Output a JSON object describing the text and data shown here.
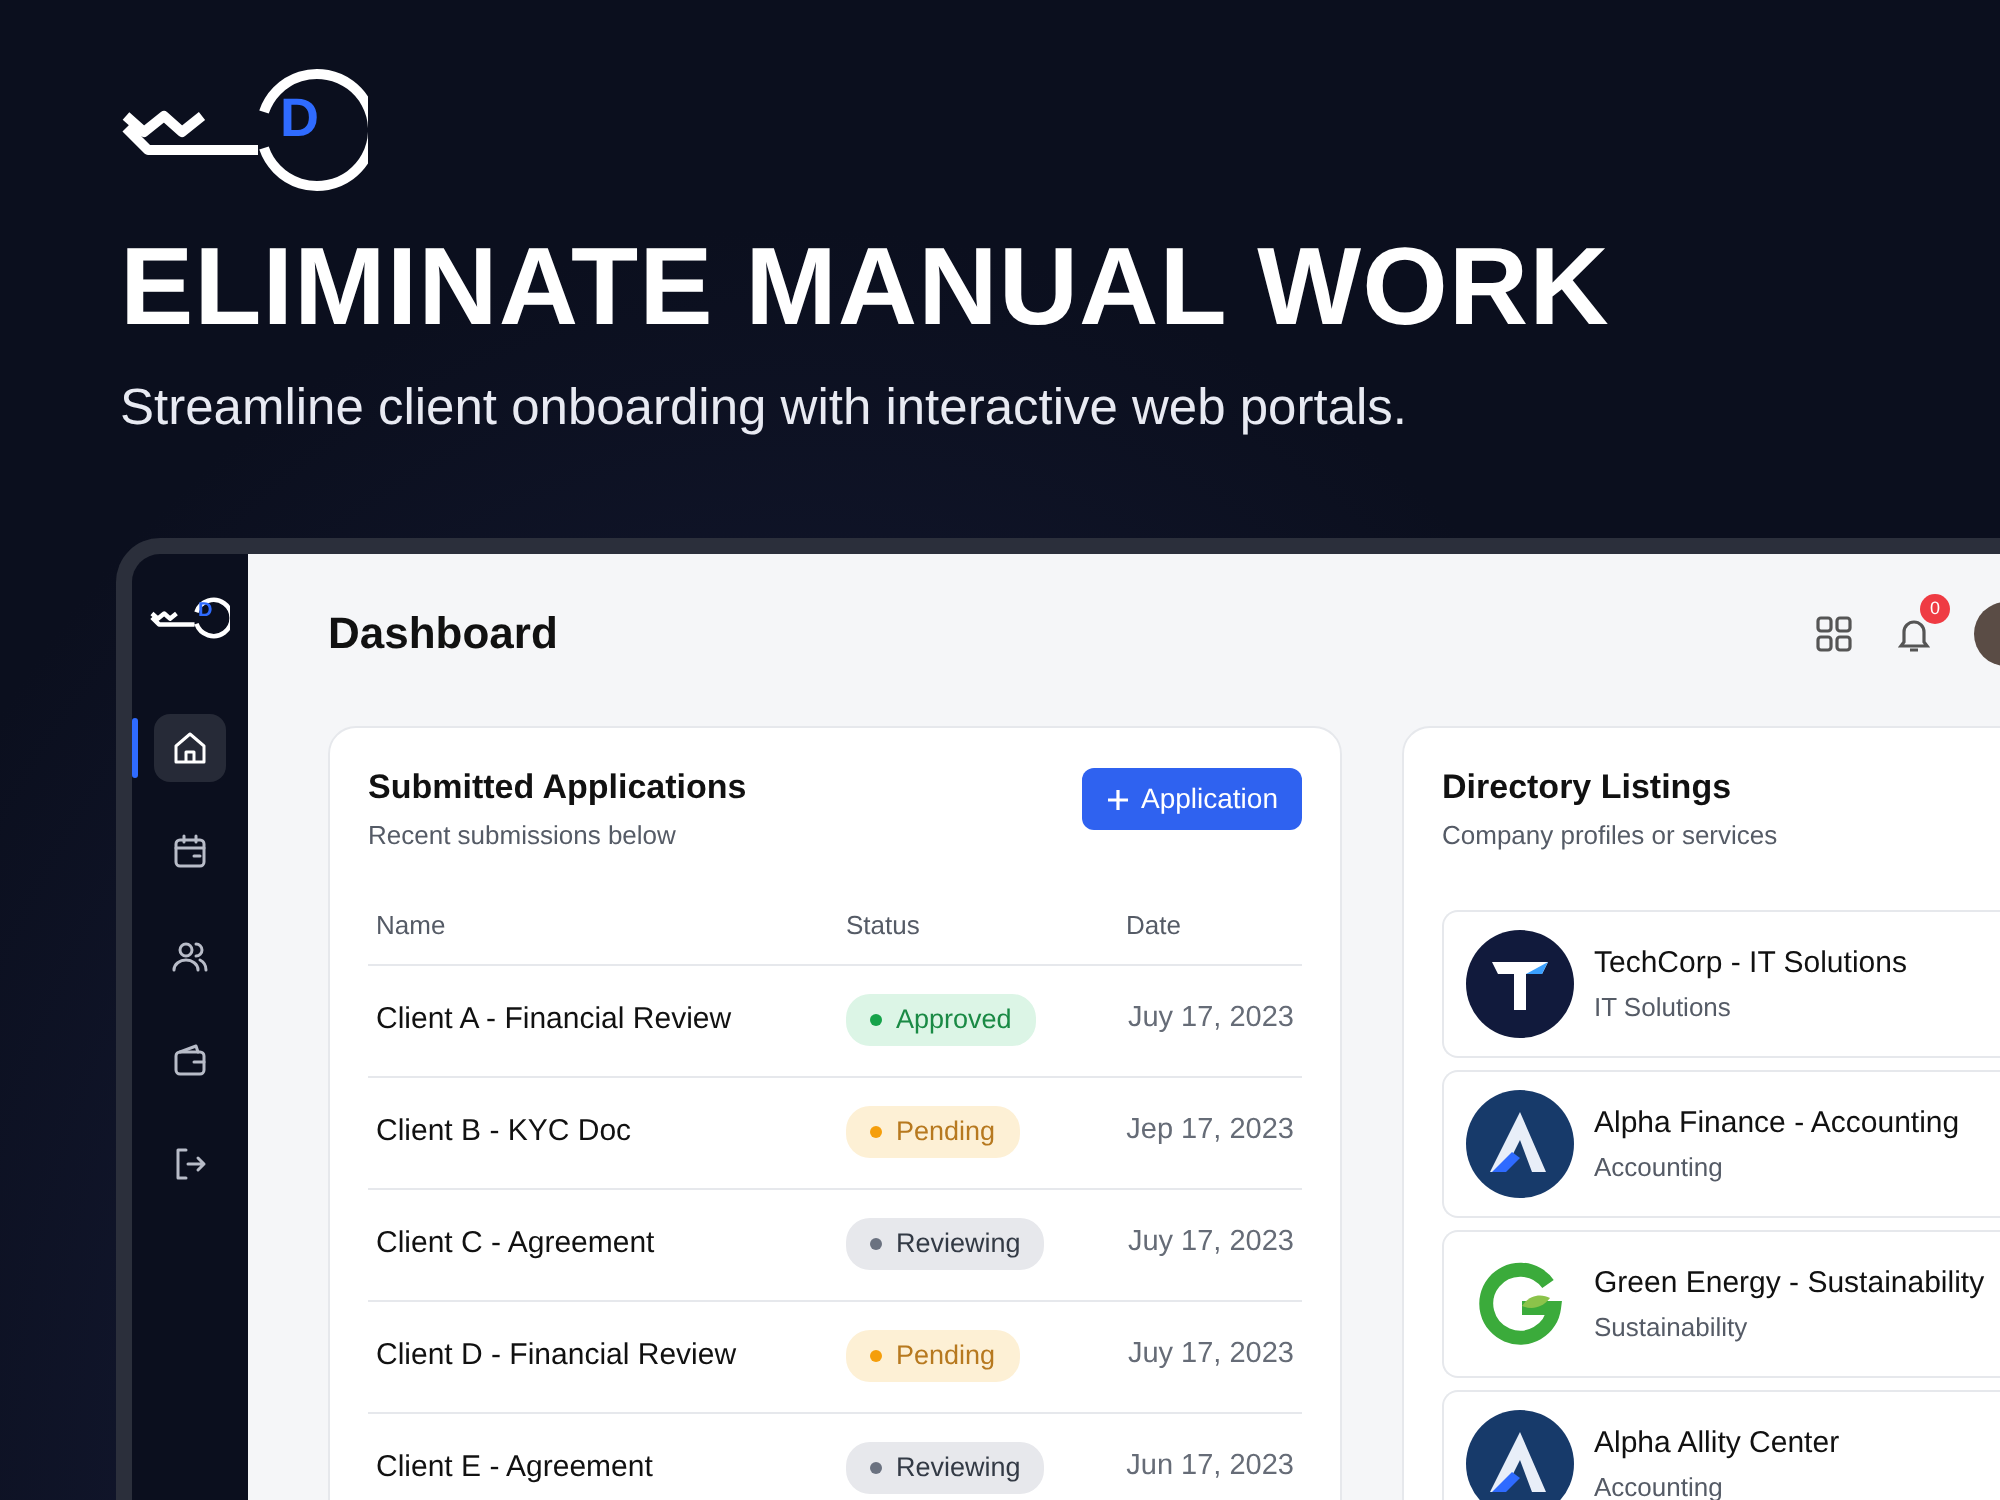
{
  "brand": {
    "letter": "D"
  },
  "headline": "ELIMINATE MANUAL WORK",
  "tagline": "Streamline client onboarding with interactive web portals.",
  "app": {
    "brand_letter": "D",
    "sidebar": {
      "items": [
        {
          "kind": "home",
          "selected": true
        },
        {
          "kind": "calendar",
          "selected": false
        },
        {
          "kind": "users",
          "selected": false
        },
        {
          "kind": "wallet",
          "selected": false
        },
        {
          "kind": "logout",
          "selected": false
        }
      ]
    },
    "page_title": "Dashboard",
    "notification_count": "0",
    "applications": {
      "title": "Submitted Applications",
      "subtitle": "Recent submissions below",
      "button": "Application",
      "columns": [
        "Name",
        "Status",
        "Date"
      ],
      "rows": [
        {
          "name": "Client A - Financial Review",
          "status": "Approved",
          "kind": "approved",
          "date": "Juy 17, 2023"
        },
        {
          "name": "Client B - KYC Doc",
          "status": "Pending",
          "kind": "pending",
          "date": "Jep 17, 2023"
        },
        {
          "name": "Client C - Agreement",
          "status": "Reviewing",
          "kind": "reviewing",
          "date": "Juy 17, 2023"
        },
        {
          "name": "Client D - Financial Review",
          "status": "Pending",
          "kind": "pending",
          "date": "Juy 17, 2023"
        },
        {
          "name": "Client E - Agreement",
          "status": "Reviewing",
          "kind": "reviewing",
          "date": "Jun 17, 2023"
        }
      ]
    },
    "directory": {
      "title": "Directory Listings",
      "subtitle": "Company profiles or services",
      "items": [
        {
          "name": "TechCorp - IT Solutions",
          "category": "IT Solutions"
        },
        {
          "name": "Alpha Finance - Accounting",
          "category": "Accounting"
        },
        {
          "name": "Green Energy - Sustainability",
          "category": "Sustainability"
        },
        {
          "name": "Alpha Allity Center",
          "category": "Accounting"
        }
      ]
    }
  }
}
